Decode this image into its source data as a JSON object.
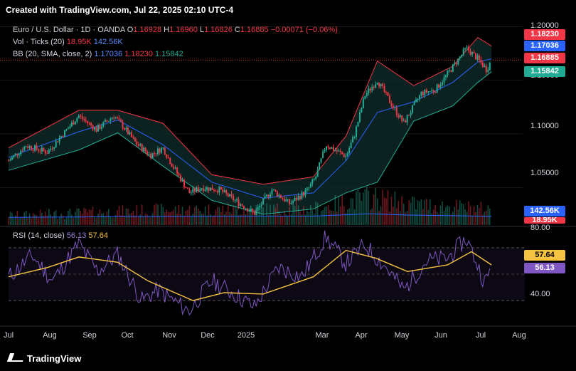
{
  "header": {
    "created_text": "Created with TradingView.com, Jul 22, 2025 02:10 UTC-4"
  },
  "legend": {
    "symbol": "Euro / U.S. Dollar · 1D · OANDA",
    "open_label": "O",
    "open": "1.16928",
    "high_label": "H",
    "high": "1.16960",
    "low_label": "L",
    "low": "1.16826",
    "close_label": "C",
    "close": "1.16885",
    "change": "−0.00071 (−0.06%)",
    "vol_label": "Vol · Ticks (20)",
    "vol_value": "18.95K",
    "vol_ma": "142.56K",
    "bb_label": "BB (20, SMA, close, 2)",
    "bb_basis": "1.17036",
    "bb_upper": "1.18230",
    "bb_lower": "1.15842",
    "rsi_label": "RSI (14, close)",
    "rsi_value": "56.13",
    "rsi_ma": "57.64"
  },
  "price_tags": {
    "upper": "1.18230",
    "basis": "1.17036",
    "close": "1.16885",
    "lower": "1.15842",
    "vol_ma": "142.56K",
    "vol": "18.95K",
    "rsi_ma": "57.64",
    "rsi": "56.13"
  },
  "colors": {
    "up": "#22ab94",
    "down": "#f23645",
    "bb_upper": "#f23645",
    "bb_basis": "#2962ff",
    "bb_lower": "#22ab94",
    "rsi": "#7e57c2",
    "rsi_ma": "#f5c242",
    "vol_ma": "#2962ff"
  },
  "footer": {
    "brand": "TradingView"
  },
  "chart_data": {
    "type": "candlestick",
    "title": "Euro / U.S. Dollar · 1D · OANDA",
    "price_axis": {
      "ticks": [
        "1.20000",
        "1.15000",
        "1.10000",
        "1.05000"
      ],
      "ylim": [
        1.015,
        1.205
      ]
    },
    "rsi_axis": {
      "ticks": [
        "80.00",
        "40.00"
      ],
      "bands": [
        70,
        30
      ],
      "ylim": [
        15,
        85
      ]
    },
    "time_axis": [
      "Jul",
      "Aug",
      "Sep",
      "Oct",
      "Nov",
      "Dec",
      "2025",
      "Mar",
      "Apr",
      "May",
      "Jun",
      "Jul",
      "Aug"
    ],
    "x_range": [
      "2024-07-01",
      "2025-08-12"
    ],
    "price_series": [
      [
        "2024-07-01",
        1.075
      ],
      [
        "2024-07-15",
        1.089
      ],
      [
        "2024-08-01",
        1.083
      ],
      [
        "2024-08-12",
        1.098
      ],
      [
        "2024-08-26",
        1.117
      ],
      [
        "2024-09-09",
        1.104
      ],
      [
        "2024-09-23",
        1.117
      ],
      [
        "2024-10-01",
        1.106
      ],
      [
        "2024-10-10",
        1.092
      ],
      [
        "2024-10-22",
        1.08
      ],
      [
        "2024-11-01",
        1.087
      ],
      [
        "2024-11-08",
        1.072
      ],
      [
        "2024-11-22",
        1.045
      ],
      [
        "2024-12-02",
        1.05
      ],
      [
        "2024-12-16",
        1.048
      ],
      [
        "2024-12-31",
        1.036
      ],
      [
        "2025-01-13",
        1.026
      ],
      [
        "2025-01-27",
        1.048
      ],
      [
        "2025-02-10",
        1.035
      ],
      [
        "2025-02-24",
        1.047
      ],
      [
        "2025-03-03",
        1.06
      ],
      [
        "2025-03-11",
        1.09
      ],
      [
        "2025-03-27",
        1.079
      ],
      [
        "2025-04-03",
        1.1
      ],
      [
        "2025-04-11",
        1.136
      ],
      [
        "2025-04-21",
        1.15
      ],
      [
        "2025-05-01",
        1.13
      ],
      [
        "2025-05-12",
        1.11
      ],
      [
        "2025-05-26",
        1.138
      ],
      [
        "2025-06-06",
        1.141
      ],
      [
        "2025-06-16",
        1.156
      ],
      [
        "2025-07-01",
        1.18
      ],
      [
        "2025-07-10",
        1.17
      ],
      [
        "2025-07-17",
        1.16
      ],
      [
        "2025-07-21",
        1.169
      ]
    ],
    "rsi_series": [
      [
        "2024-07-01",
        48
      ],
      [
        "2024-07-20",
        64
      ],
      [
        "2024-08-05",
        45
      ],
      [
        "2024-08-26",
        73
      ],
      [
        "2024-09-10",
        52
      ],
      [
        "2024-09-26",
        65
      ],
      [
        "2024-10-15",
        30
      ],
      [
        "2024-10-28",
        38
      ],
      [
        "2024-11-22",
        22
      ],
      [
        "2024-12-10",
        45
      ],
      [
        "2024-12-28",
        35
      ],
      [
        "2025-01-13",
        25
      ],
      [
        "2025-02-01",
        55
      ],
      [
        "2025-02-20",
        48
      ],
      [
        "2025-03-11",
        78
      ],
      [
        "2025-03-27",
        58
      ],
      [
        "2025-04-11",
        72
      ],
      [
        "2025-04-28",
        55
      ],
      [
        "2025-05-12",
        38
      ],
      [
        "2025-05-30",
        60
      ],
      [
        "2025-06-16",
        62
      ],
      [
        "2025-07-01",
        77
      ],
      [
        "2025-07-16",
        43
      ],
      [
        "2025-07-21",
        56
      ]
    ],
    "rsi_ma_series": [
      [
        "2024-07-01",
        48
      ],
      [
        "2024-08-01",
        55
      ],
      [
        "2024-08-26",
        63
      ],
      [
        "2024-09-26",
        59
      ],
      [
        "2024-10-20",
        45
      ],
      [
        "2024-11-25",
        30
      ],
      [
        "2024-12-20",
        36
      ],
      [
        "2025-01-20",
        35
      ],
      [
        "2025-03-01",
        48
      ],
      [
        "2025-03-27",
        68
      ],
      [
        "2025-04-20",
        62
      ],
      [
        "2025-05-15",
        52
      ],
      [
        "2025-06-16",
        57
      ],
      [
        "2025-07-05",
        67
      ],
      [
        "2025-07-21",
        57
      ]
    ],
    "bb_upper_series": [
      [
        "2024-07-01",
        1.087
      ],
      [
        "2024-08-26",
        1.122
      ],
      [
        "2024-09-26",
        1.122
      ],
      [
        "2024-11-01",
        1.11
      ],
      [
        "2024-12-10",
        1.062
      ],
      [
        "2025-01-20",
        1.053
      ],
      [
        "2025-03-01",
        1.06
      ],
      [
        "2025-03-27",
        1.098
      ],
      [
        "2025-04-21",
        1.168
      ],
      [
        "2025-05-20",
        1.145
      ],
      [
        "2025-06-20",
        1.163
      ],
      [
        "2025-07-10",
        1.19
      ],
      [
        "2025-07-21",
        1.182
      ]
    ],
    "bb_basis_series": [
      [
        "2024-07-01",
        1.078
      ],
      [
        "2024-08-26",
        1.102
      ],
      [
        "2024-09-26",
        1.113
      ],
      [
        "2024-11-01",
        1.09
      ],
      [
        "2024-12-10",
        1.055
      ],
      [
        "2025-01-20",
        1.04
      ],
      [
        "2025-03-01",
        1.045
      ],
      [
        "2025-03-27",
        1.075
      ],
      [
        "2025-04-21",
        1.12
      ],
      [
        "2025-05-20",
        1.13
      ],
      [
        "2025-06-20",
        1.148
      ],
      [
        "2025-07-10",
        1.167
      ],
      [
        "2025-07-21",
        1.17
      ]
    ],
    "bb_lower_series": [
      [
        "2024-07-01",
        1.066
      ],
      [
        "2024-08-26",
        1.085
      ],
      [
        "2024-09-26",
        1.101
      ],
      [
        "2024-11-01",
        1.07
      ],
      [
        "2024-12-10",
        1.038
      ],
      [
        "2025-01-20",
        1.025
      ],
      [
        "2025-03-01",
        1.03
      ],
      [
        "2025-03-27",
        1.045
      ],
      [
        "2025-04-21",
        1.055
      ],
      [
        "2025-05-20",
        1.112
      ],
      [
        "2025-06-20",
        1.126
      ],
      [
        "2025-07-10",
        1.148
      ],
      [
        "2025-07-21",
        1.158
      ]
    ],
    "volume_series": [
      [
        "2024-07-01",
        90
      ],
      [
        "2024-09-01",
        115
      ],
      [
        "2024-11-01",
        140
      ],
      [
        "2025-01-01",
        145
      ],
      [
        "2025-03-01",
        150
      ],
      [
        "2025-04-15",
        260
      ],
      [
        "2025-05-15",
        200
      ],
      [
        "2025-07-21",
        143
      ]
    ]
  }
}
